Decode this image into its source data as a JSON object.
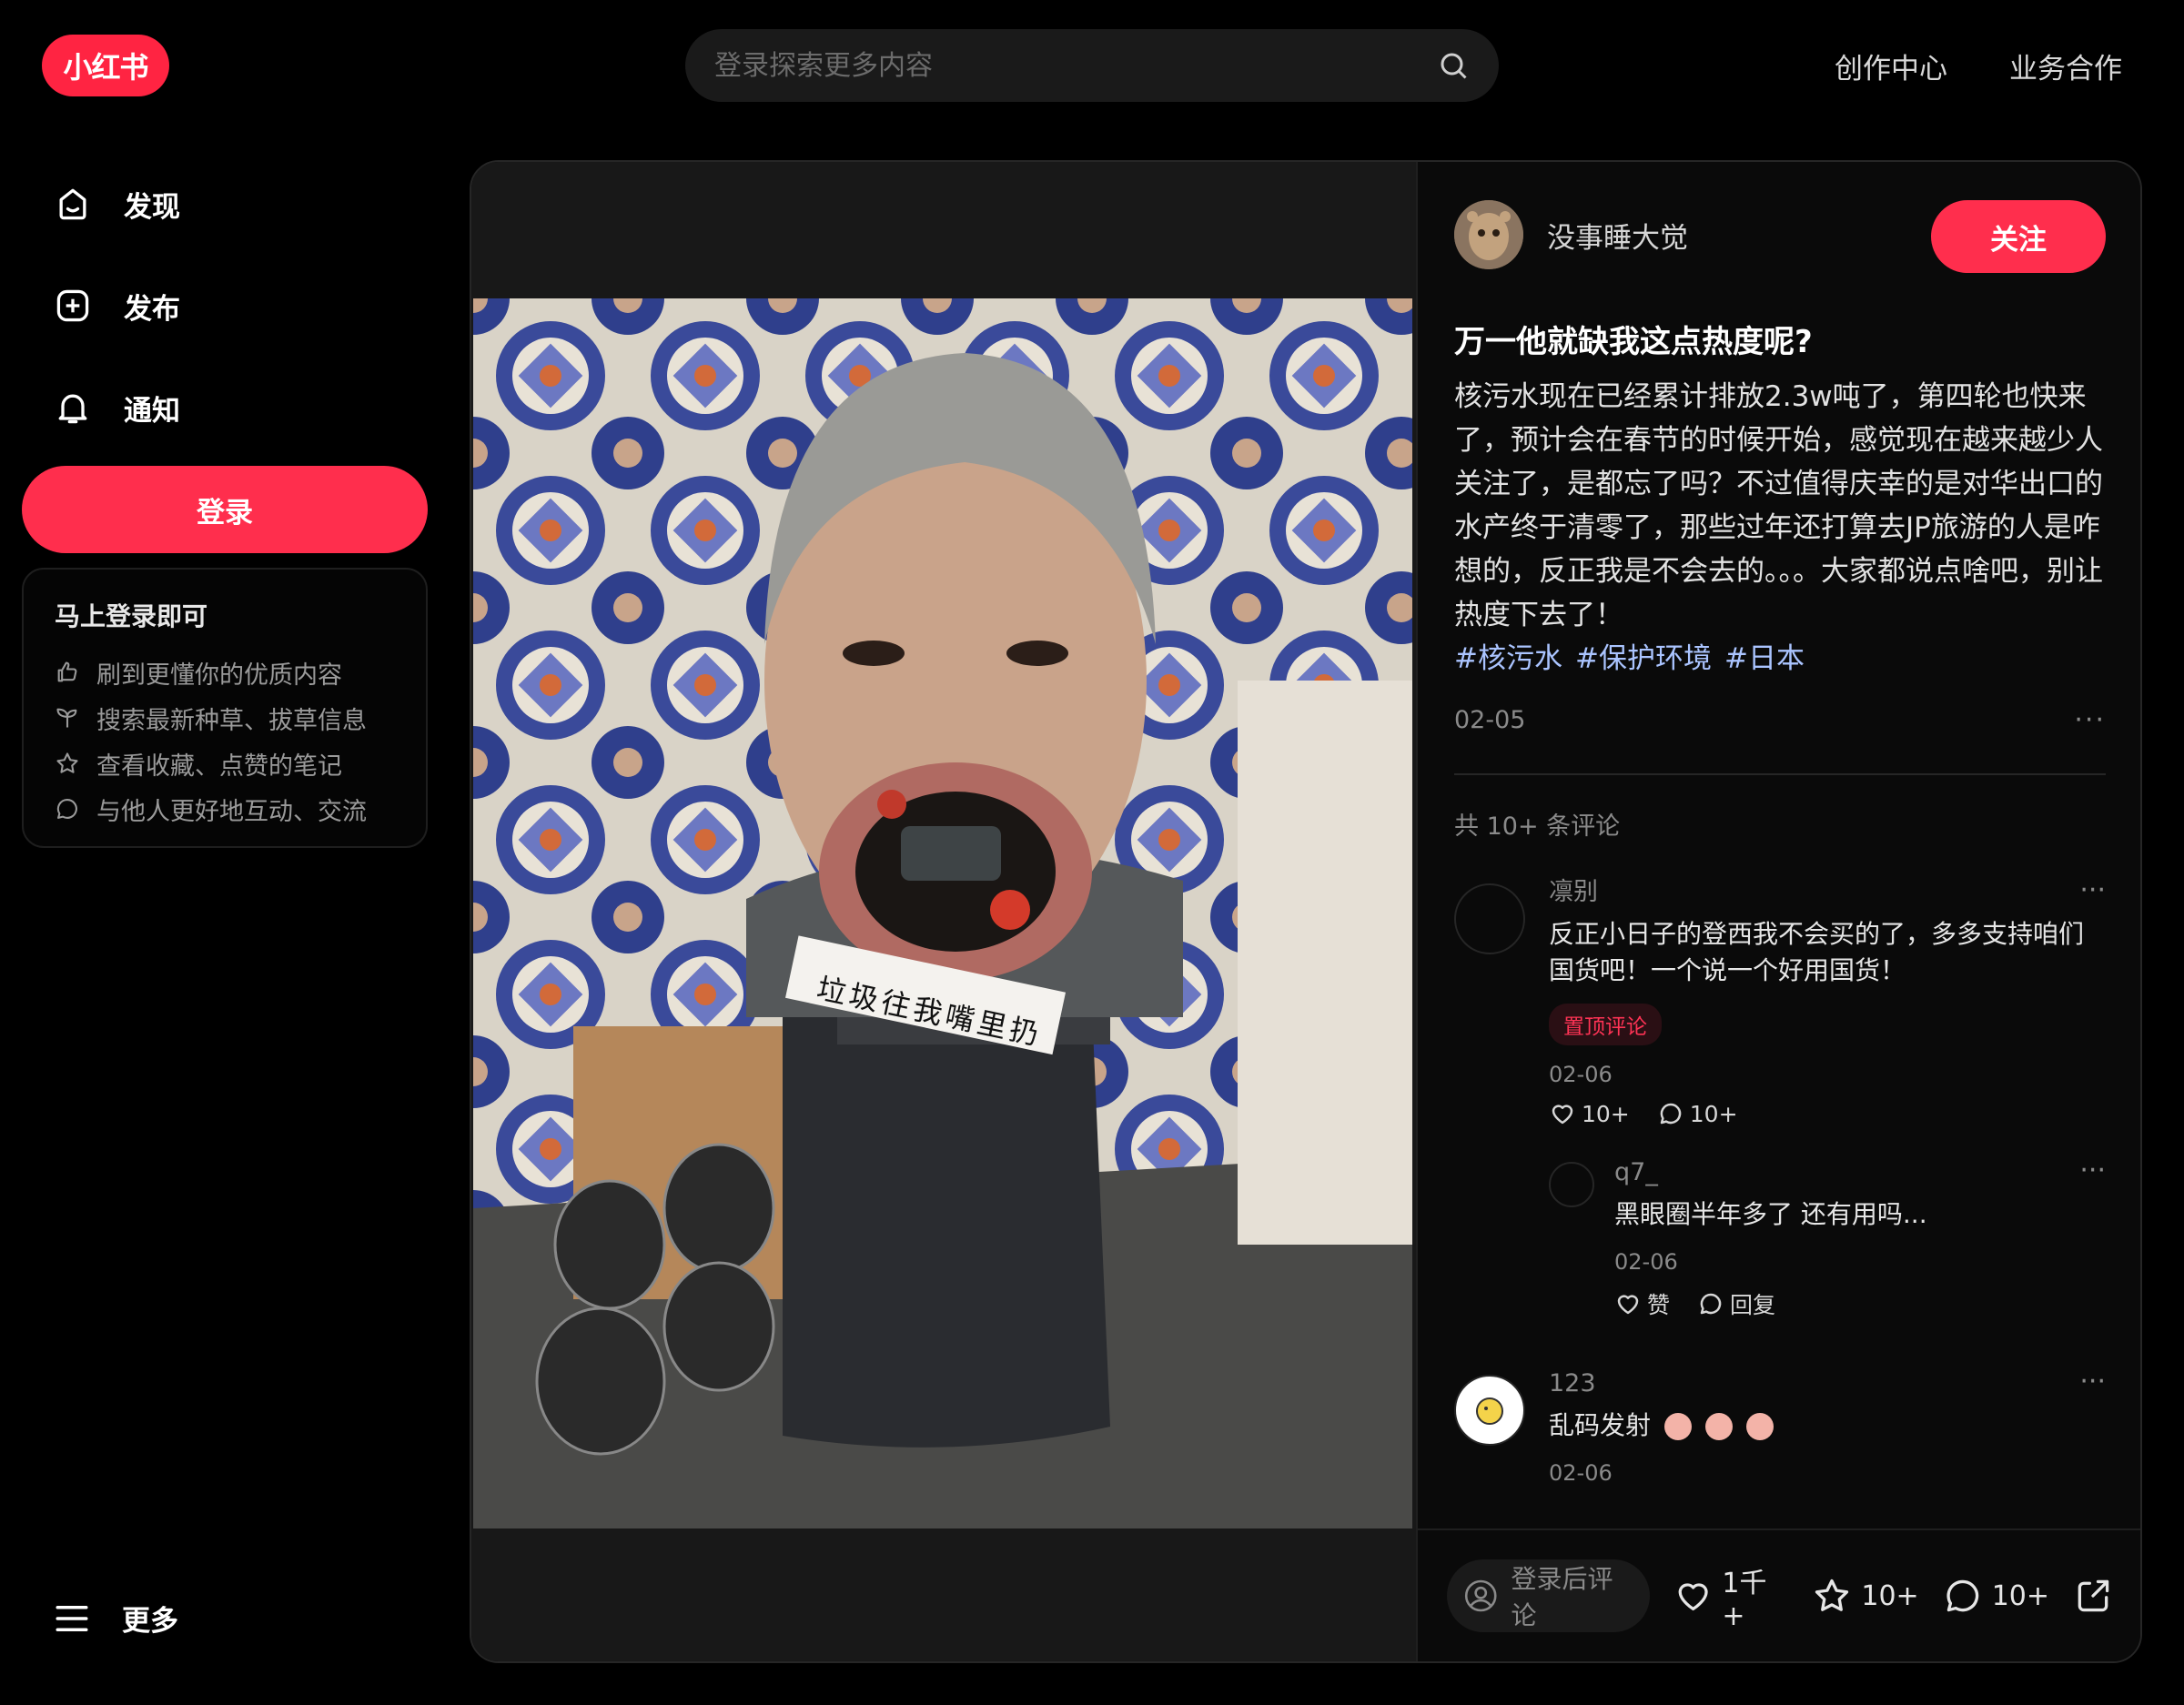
{
  "header": {
    "logo_text": "小红书",
    "search_placeholder": "登录探索更多内容",
    "links": [
      "创作中心",
      "业务合作"
    ]
  },
  "sidebar": {
    "items": [
      {
        "label": "发现",
        "icon": "home-icon"
      },
      {
        "label": "发布",
        "icon": "plus-square-icon"
      },
      {
        "label": "通知",
        "icon": "bell-icon"
      }
    ],
    "login_label": "登录",
    "promo": {
      "title": "马上登录即可",
      "items": [
        {
          "icon": "thumbs-up-icon",
          "text": "刷到更懂你的优质内容"
        },
        {
          "icon": "sprout-icon",
          "text": "搜索最新种草、拔草信息"
        },
        {
          "icon": "star-icon",
          "text": "查看收藏、点赞的笔记"
        },
        {
          "icon": "chat-bubble-icon",
          "text": "与他人更好地互动、交流"
        }
      ]
    },
    "more_label": "更多"
  },
  "note": {
    "image_caption": "垃圾往我嘴里扔",
    "author": "没事睡大觉",
    "follow_label": "关注",
    "title": "万一他就缺我这点热度呢?",
    "desc": "核污水现在已经累计排放2.3w吨了，第四轮也快来了，预计会在春节的时候开始，感觉现在越来越少人关注了，是都忘了吗？不过值得庆幸的是对华出口的水产终于清零了，那些过年还打算去JP旅游的人是咋想的，反正我是不会去的。。。大家都说点啥吧，别让热度下去了！",
    "tags": [
      "#核污水",
      "#保护环境",
      "#日本"
    ],
    "date": "02-05",
    "comment_count": "共 10+ 条评论"
  },
  "comments": [
    {
      "name": "凛别",
      "text": "反正小日子的登西我不会买的了，多多支持咱们国货吧！一个说一个好用国货！",
      "pin": "置顶评论",
      "date": "02-06",
      "likes": "10+",
      "replies": "10+"
    },
    {
      "name": "123",
      "text": "乱码发射",
      "date": "02-06"
    }
  ],
  "reply": {
    "name": "q7_",
    "text": "黑眼圈半年多了 还有用吗...",
    "date": "02-06",
    "like_label": "赞",
    "reply_label": "回复"
  },
  "bottom": {
    "comment_placeholder": "登录后评论",
    "likes": "1千+",
    "collects": "10+",
    "comments": "10+"
  },
  "colors": {
    "brand": "#ff2442",
    "background": "#000000",
    "tag": "#aac4ff"
  }
}
